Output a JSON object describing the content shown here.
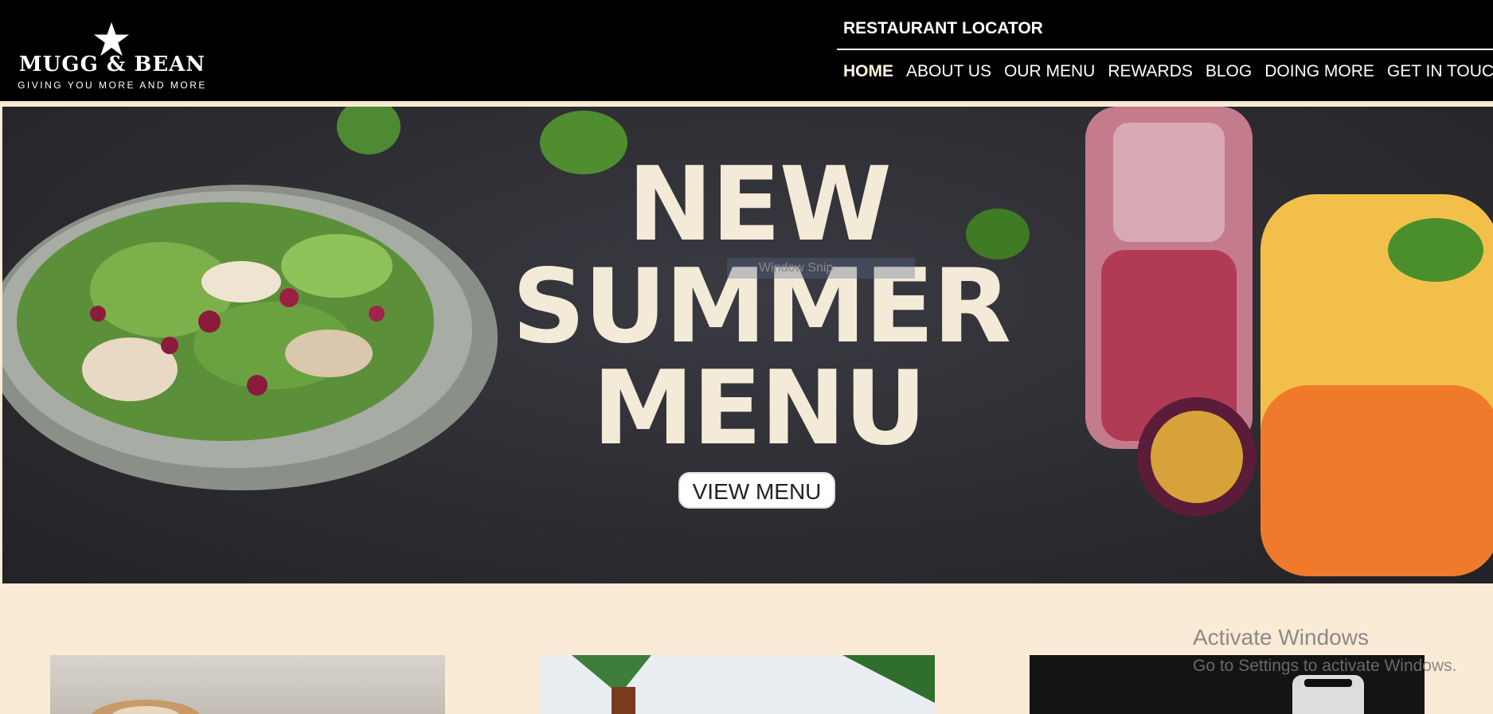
{
  "header": {
    "logo": {
      "name": "MUGG & BEAN",
      "tagline": "GIVING YOU MORE AND MORE",
      "icon": "star-icon"
    },
    "locator_label": "RESTAURANT LOCATOR",
    "nav": [
      {
        "label": "HOME",
        "active": true
      },
      {
        "label": "ABOUT US",
        "active": false
      },
      {
        "label": "OUR MENU",
        "active": false
      },
      {
        "label": "REWARDS",
        "active": false
      },
      {
        "label": "BLOG",
        "active": false
      },
      {
        "label": "DOING MORE",
        "active": false
      },
      {
        "label": "GET IN TOUCH",
        "active": false
      }
    ]
  },
  "hero": {
    "headline_line1": "NEW",
    "headline_line2": "SUMMER",
    "headline_line3": "MENU",
    "cta_label": "VIEW MENU",
    "overlay_text": "Window Snip"
  },
  "cards": [
    {
      "id": "card-coffee",
      "partial_text": "...C..."
    },
    {
      "id": "card-tropical"
    },
    {
      "id": "card-phone"
    }
  ],
  "watermark": {
    "title": "Activate Windows",
    "subtitle": "Go to Settings to activate Windows."
  },
  "colors": {
    "header_bg": "#000000",
    "page_bg": "#faebd7",
    "headline": "#f3ead8",
    "hero_bg": "#2b2b30"
  }
}
